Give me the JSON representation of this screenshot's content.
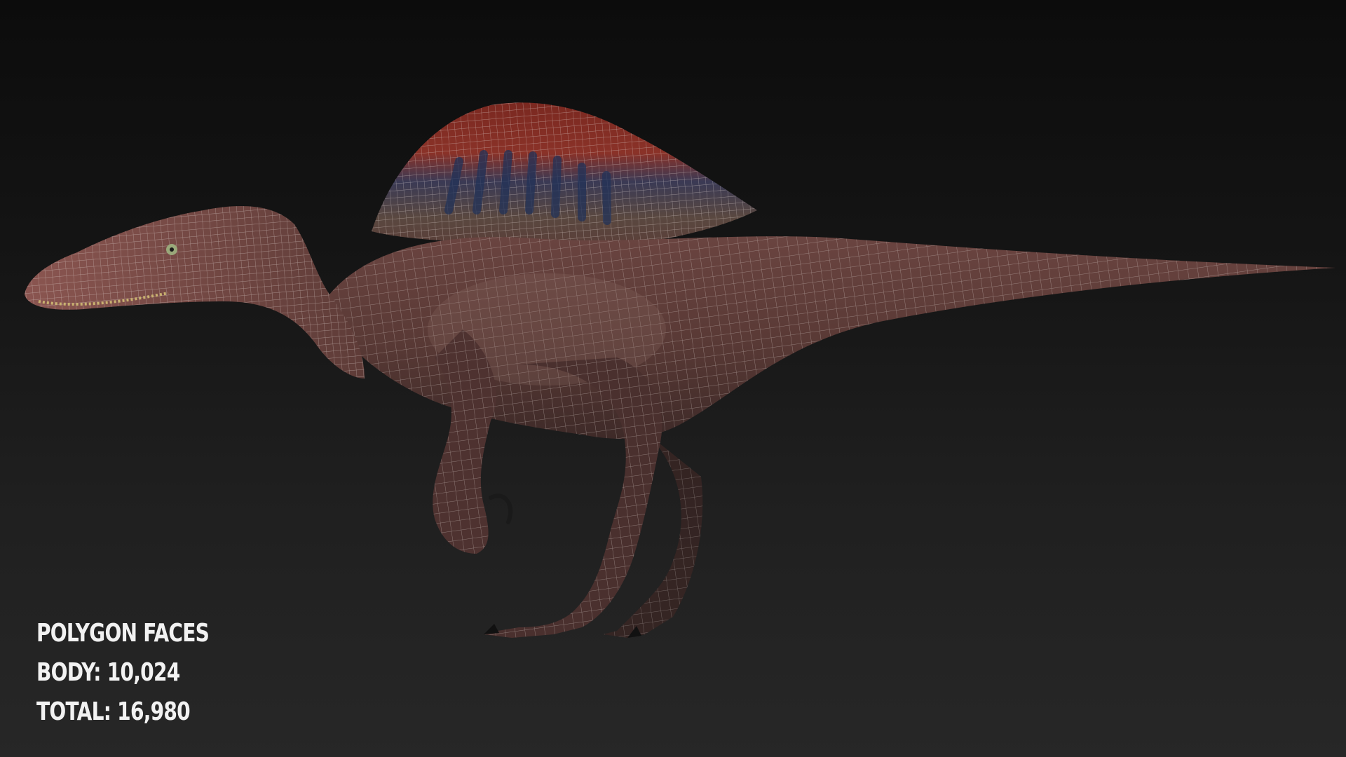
{
  "stats": {
    "heading": "POLYGON FACES",
    "body_label": "BODY:",
    "body_value": "10,024",
    "total_label": "TOTAL:",
    "total_value": "16,980"
  },
  "colors": {
    "background_top": "#0c0c0c",
    "background_bottom": "#272727",
    "skin": "#5a3a36",
    "wire": "#cfc2bf",
    "sail_red": "#8a2a22",
    "sail_blue": "#2a3e6a",
    "text": "#f2f2f2"
  },
  "model": {
    "subject_icon": "spinosaurus-wireframe-render-icon"
  }
}
